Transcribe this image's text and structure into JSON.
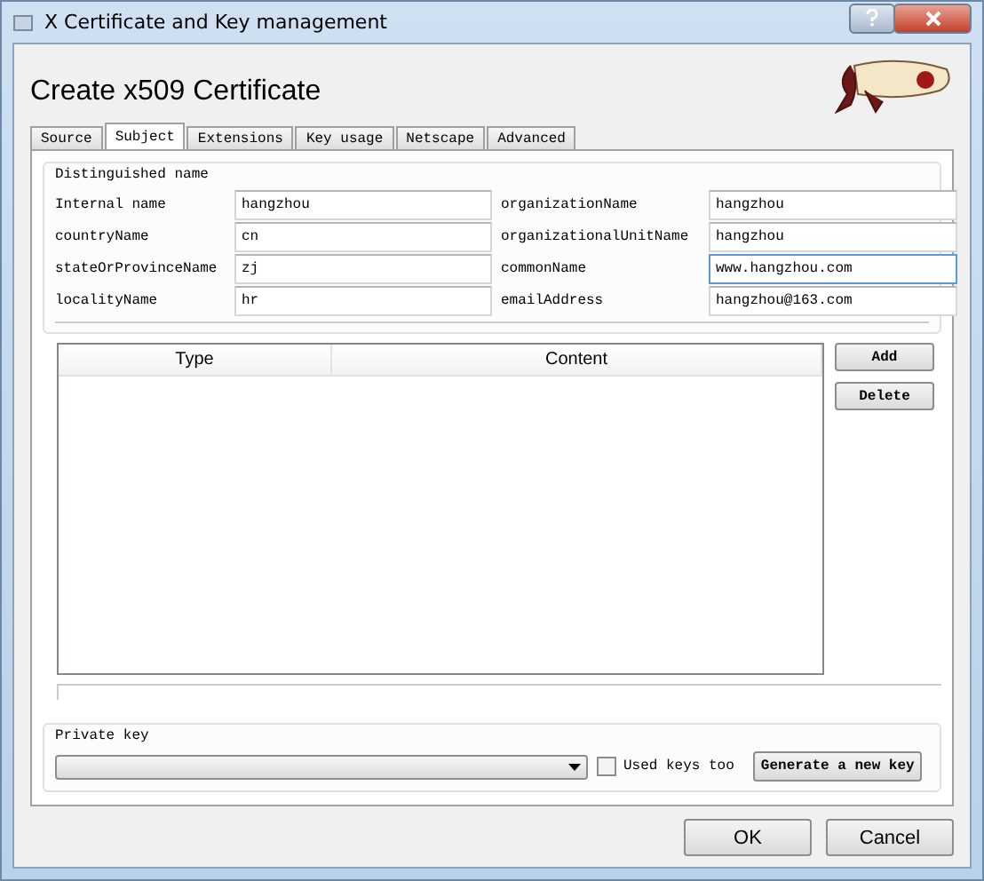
{
  "window": {
    "title": "X Certificate and Key management"
  },
  "header": {
    "title": "Create x509 Certificate"
  },
  "tabs": [
    {
      "label": "Source",
      "selected": false
    },
    {
      "label": "Subject",
      "selected": true
    },
    {
      "label": "Extensions",
      "selected": false
    },
    {
      "label": "Key usage",
      "selected": false
    },
    {
      "label": "Netscape",
      "selected": false
    },
    {
      "label": "Advanced",
      "selected": false
    }
  ],
  "distinguished_name": {
    "title": "Distinguished name",
    "fields": [
      {
        "label": "Internal name",
        "value": "hangzhou",
        "focused": false
      },
      {
        "label": "organizationName",
        "value": "hangzhou",
        "focused": false
      },
      {
        "label": "countryName",
        "value": "cn",
        "focused": false
      },
      {
        "label": "organizationalUnitName",
        "value": "hangzhou",
        "focused": false
      },
      {
        "label": "stateOrProvinceName",
        "value": "zj",
        "focused": false
      },
      {
        "label": "commonName",
        "value": "www.hangzhou.com",
        "focused": true
      },
      {
        "label": "localityName",
        "value": "hr",
        "focused": false
      },
      {
        "label": "emailAddress",
        "value": "hangzhou@163.com",
        "focused": false
      }
    ]
  },
  "table": {
    "columns": [
      "Type",
      "Content"
    ]
  },
  "table_buttons": [
    "Add",
    "Delete"
  ],
  "private_key": {
    "title": "Private key",
    "used_keys_too": {
      "label": "Used keys too",
      "checked": false
    },
    "button": "Generate a new key"
  },
  "buttons": [
    "OK",
    "Cancel"
  ]
}
